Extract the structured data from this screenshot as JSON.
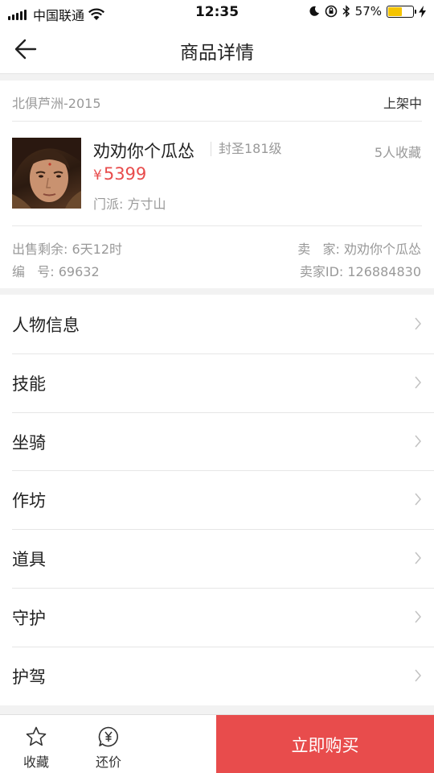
{
  "status_bar": {
    "carrier": "中国联通",
    "time": "12:35",
    "battery": "57%",
    "battery_level": 0.57
  },
  "nav": {
    "title": "商品详情"
  },
  "product": {
    "server": "北俱芦洲-2015",
    "state": "上架中",
    "name": "劝劝你个瓜怂",
    "level": "封圣181级",
    "favorites": "5人收藏",
    "currency": "¥",
    "price": "5399",
    "sect": "门派: 方寸山",
    "remaining": "出售剩余: 6天12时",
    "number": "编   号: 69632",
    "seller": "卖   家: 劝劝你个瓜怂",
    "seller_id": "卖家ID: 126884830"
  },
  "menu": [
    {
      "label": "人物信息"
    },
    {
      "label": "技能"
    },
    {
      "label": "坐骑"
    },
    {
      "label": "作坊"
    },
    {
      "label": "道具"
    },
    {
      "label": "守护"
    },
    {
      "label": "护驾"
    }
  ],
  "bottom": {
    "favorite_label": "收藏",
    "bargain_label": "还价",
    "buy_label": "立即购买"
  },
  "colors": {
    "accent": "#e84c4c",
    "battery": "#f5c400"
  },
  "icons": [
    "back-arrow-icon",
    "star-icon",
    "yen-bubble-icon",
    "chevron-right-icon",
    "wifi-icon",
    "moon-icon",
    "lock-rotation-icon",
    "bluetooth-icon",
    "charging-icon"
  ]
}
